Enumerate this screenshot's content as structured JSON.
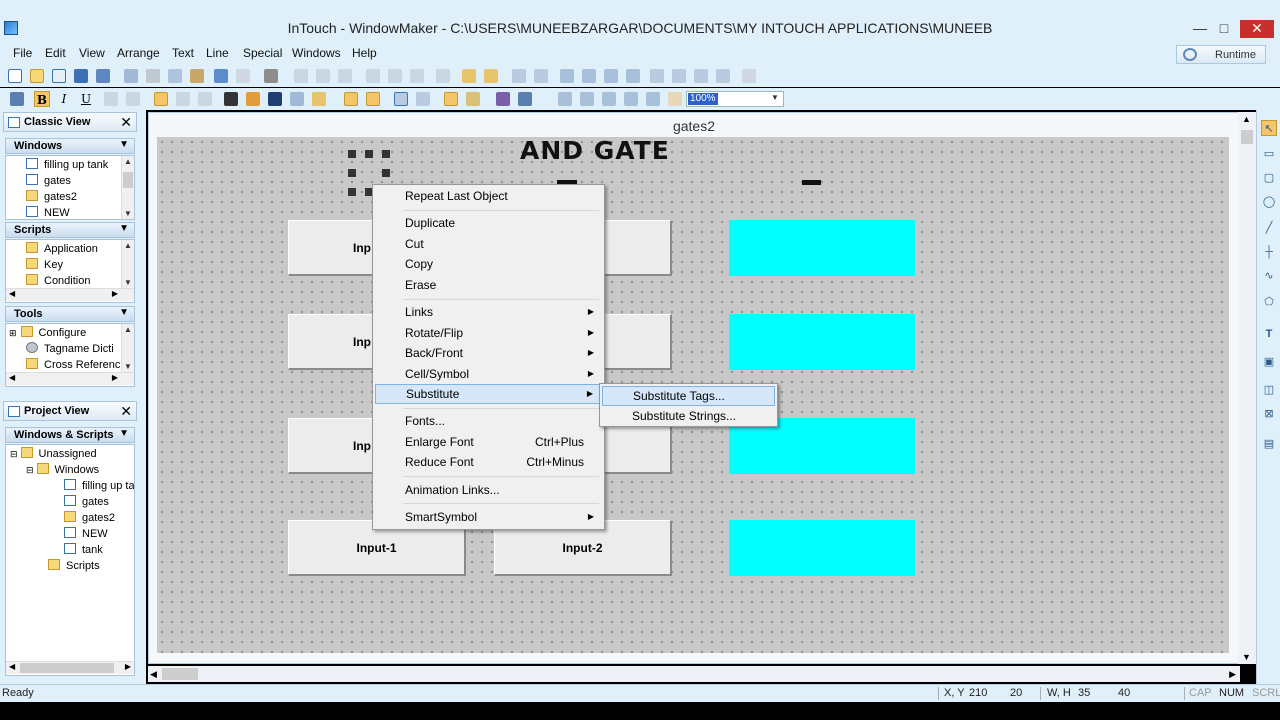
{
  "window": {
    "title": "InTouch - WindowMaker - C:\\USERS\\MUNEEBZARGAR\\DOCUMENTS\\MY INTOUCH APPLICATIONS\\MUNEEB",
    "minimize": "—",
    "maximize": "□",
    "close": "✕"
  },
  "menubar": {
    "items": [
      "File",
      "Edit",
      "View",
      "Arrange",
      "Text",
      "Line",
      "Special",
      "Windows",
      "Help"
    ],
    "runtime_label": "Runtime"
  },
  "toolbar2": {
    "bold": "B",
    "italic": "I",
    "underline": "U",
    "zoom": "100%"
  },
  "classic_view": {
    "title": "Classic View",
    "close": "✕",
    "windows": {
      "header": "Windows",
      "items": [
        "filling up tank",
        "gates",
        "gates2",
        "NEW"
      ]
    },
    "scripts": {
      "header": "Scripts",
      "items": [
        "Application",
        "Key",
        "Condition"
      ]
    },
    "tools": {
      "header": "Tools",
      "items": [
        "Configure",
        "Tagname Dicti",
        "Cross Referenc"
      ]
    }
  },
  "project_view": {
    "title": "Project View",
    "close": "✕",
    "header": "Windows & Scripts",
    "tree": {
      "root": "Unassigned",
      "windows": "Windows",
      "items": [
        "filling up ta",
        "gates",
        "gates2",
        "NEW",
        "tank"
      ],
      "scripts": "Scripts"
    }
  },
  "document": {
    "title": "gates2",
    "gate_title": "AND GATE",
    "buttons": [
      {
        "left": "Inp",
        "right": ""
      },
      {
        "left": "Inp",
        "right": ""
      },
      {
        "left": "Inp",
        "right": ""
      },
      {
        "left": "Input-1",
        "right": "Input-2"
      }
    ]
  },
  "context_menu": {
    "items": [
      {
        "label": "Repeat Last Object"
      },
      {
        "label": "Duplicate"
      },
      {
        "label": "Cut"
      },
      {
        "label": "Copy"
      },
      {
        "label": "Erase"
      },
      {
        "label": "Links",
        "submenu": true
      },
      {
        "label": "Rotate/Flip",
        "submenu": true
      },
      {
        "label": "Back/Front",
        "submenu": true
      },
      {
        "label": "Cell/Symbol",
        "submenu": true
      },
      {
        "label": "Substitute",
        "submenu": true,
        "highlighted": true
      },
      {
        "label": "Fonts..."
      },
      {
        "label": "Enlarge Font",
        "shortcut": "Ctrl+Plus"
      },
      {
        "label": "Reduce Font",
        "shortcut": "Ctrl+Minus"
      },
      {
        "label": "Animation Links..."
      },
      {
        "label": "SmartSymbol",
        "submenu": true
      }
    ],
    "submenu_arrow": "▶"
  },
  "substitute_submenu": {
    "items": [
      "Substitute Tags...",
      "Substitute Strings..."
    ]
  },
  "statusbar": {
    "ready": "Ready",
    "xy_label": "X, Y",
    "x": "210",
    "y": "20",
    "wh_label": "W, H",
    "w": "35",
    "h": "40",
    "cap": "CAP",
    "num": "NUM",
    "scrl": "SCRL"
  },
  "colors": {
    "chrome": "#dff0fb",
    "canvas": "#c8c8c8",
    "output": "#00ffff",
    "highlight": "#d5e7f8"
  }
}
